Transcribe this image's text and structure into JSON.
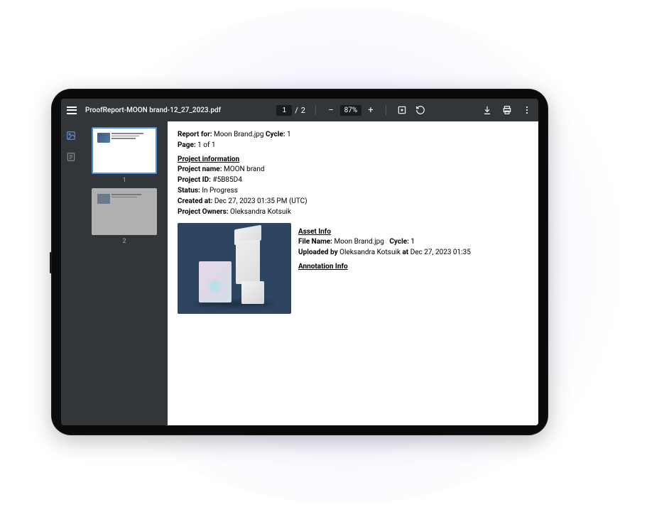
{
  "toolbar": {
    "file_title": "ProofReport-MOON brand-12_27_2023.pdf",
    "page_current": "1",
    "page_separator": "/",
    "page_total": "2",
    "zoom_level": "87%"
  },
  "thumbnails": [
    {
      "label": "1"
    },
    {
      "label": "2"
    }
  ],
  "report": {
    "header": {
      "report_for_label": "Report for:",
      "report_for_value": "Moon Brand.jpg",
      "cycle_label": "Cycle:",
      "cycle_value": "1",
      "page_label": "Page:",
      "page_value": "1 of 1"
    },
    "project_info": {
      "section_title": "Project information",
      "name_label": "Project name:",
      "name_value": "MOON brand",
      "id_label": "Project ID:",
      "id_value": "#5B85D4",
      "status_label": "Status:",
      "status_value": "In Progress",
      "created_label": "Created at:",
      "created_value": "Dec 27, 2023 01:35 PM (UTC)",
      "owners_label": "Project Owners:",
      "owners_value": "Oleksandra Kotsuik"
    },
    "asset_info": {
      "section_title": "Asset Info",
      "file_name_label": "File Name:",
      "file_name_value": "Moon Brand.jpg",
      "cycle_label": "Cycle:",
      "cycle_value": "1",
      "uploaded_by_label": "Uploaded by",
      "uploaded_by_value": "Oleksandra Kotsuik",
      "at_label": "at",
      "at_value": "Dec 27, 2023 01:35",
      "annotation_title": "Annotation Info"
    }
  }
}
